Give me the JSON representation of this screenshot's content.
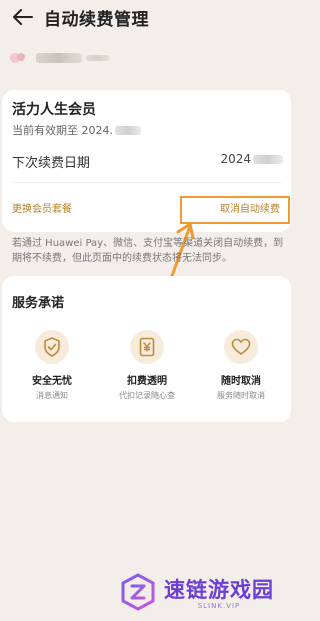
{
  "header": {
    "title": "自动续费管理",
    "back_icon": "back-arrow-icon"
  },
  "membership": {
    "plan_name": "活力人生会员",
    "validity_prefix": "当前有效期至 2024.",
    "next_renewal_label": "下次续费日期",
    "next_renewal_value": "2024",
    "change_plan_link": "更换会员套餐",
    "cancel_link": "取消自动续费"
  },
  "notice": "若通过 Huawei Pay、微信、支付宝等渠道关闭自动续费，到期将不续费，但此页面中的续费状态将无法同步。",
  "service": {
    "title": "服务承诺",
    "items": [
      {
        "name": "安全无忧",
        "desc": "消息通知",
        "icon": "shield-check-icon"
      },
      {
        "name": "扣费透明",
        "desc": "代扣记录随心查",
        "icon": "yuan-receipt-icon"
      },
      {
        "name": "随时取消",
        "desc": "服务随时取消",
        "icon": "heart-icon"
      }
    ]
  },
  "watermark": {
    "main": "速链游戏园",
    "sub": "SLINK.VIP"
  },
  "colors": {
    "accent": "#b6822e",
    "highlight": "#f29a32",
    "background": "#f3eeea",
    "watermark": "#6b3fd6"
  }
}
